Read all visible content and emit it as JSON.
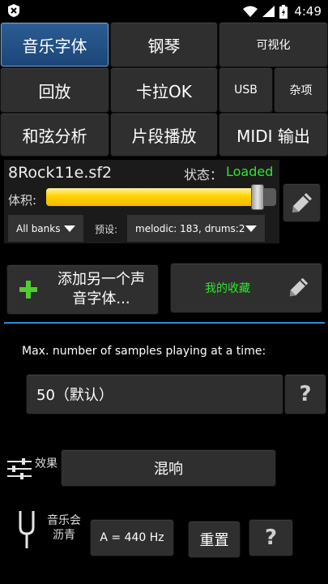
{
  "statusbar": {
    "time": "4:49"
  },
  "tabs": [
    {
      "label": "音乐字体"
    },
    {
      "label": "钢琴"
    },
    {
      "label": "可视化"
    },
    {
      "label": "回放"
    },
    {
      "label": "卡拉OK"
    },
    {
      "label": "USB"
    },
    {
      "label": "杂项"
    },
    {
      "label": "和弦分析"
    },
    {
      "label": "片段播放"
    },
    {
      "label": "MIDI 输出"
    }
  ],
  "soundfont": {
    "file_name": "8Rock11e.sf2",
    "status_label": "状态：",
    "status_value": "Loaded",
    "volume_label": "体积:",
    "volume_level": 0.92,
    "bank_select": "All banks",
    "preset_label": "预设:",
    "preset_select": "melodic: 183, drums:2"
  },
  "actions": {
    "add_soundfont_line1": "添加另一个声",
    "add_soundfont_line2": "音字体...",
    "favorites": "我的收藏"
  },
  "samples": {
    "label": "Max. number of samples playing at a time:",
    "value": "50（默认）",
    "help": "?"
  },
  "effects": {
    "label": "效果",
    "button": "混响"
  },
  "tuning": {
    "label_line1": "音乐会",
    "label_line2": "沥青",
    "value": "A = 440 Hz",
    "reset": "重置",
    "help": "?"
  },
  "colors": {
    "accent": "#2a8fd6",
    "loaded_status": "#2ee52e",
    "favorites_text": "#2ee52e",
    "slider_fill": "#ffd200"
  }
}
